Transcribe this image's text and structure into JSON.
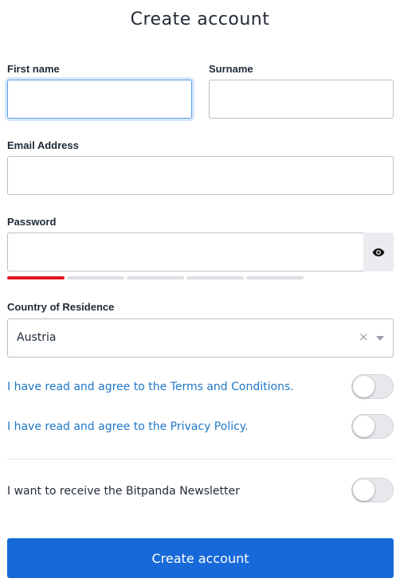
{
  "page": {
    "title": "Create account"
  },
  "form": {
    "first_name": {
      "label": "First name",
      "value": ""
    },
    "surname": {
      "label": "Surname",
      "value": ""
    },
    "email": {
      "label": "Email Address",
      "value": ""
    },
    "password": {
      "label": "Password",
      "value": "",
      "toggle_icon": "eye-icon",
      "strength_segments_total": 5,
      "strength_segments_filled": 1,
      "strength_color": "#e3151a"
    },
    "country": {
      "label": "Country of Residence",
      "selected": "Austria",
      "clear_symbol": "×",
      "caret_icon": "chevron-down-icon"
    },
    "terms": {
      "text": "I have read and agree to the Terms and Conditions.",
      "enabled": false
    },
    "privacy": {
      "text": "I have read and agree to the Privacy Policy.",
      "enabled": false
    },
    "newsletter": {
      "text": "I want to receive the Bitpanda Newsletter",
      "enabled": false
    },
    "submit_label": "Create account"
  },
  "colors": {
    "accent": "#1769d9",
    "link": "#2178c8",
    "focus": "#5aa0e8"
  }
}
